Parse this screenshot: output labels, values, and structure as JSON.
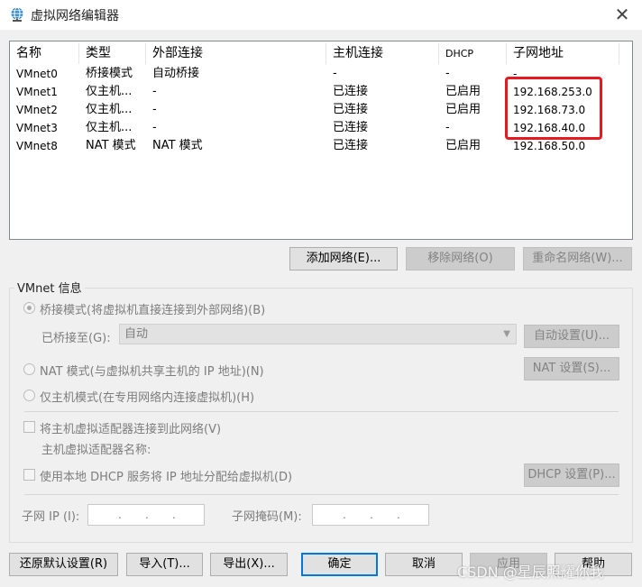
{
  "window": {
    "title": "虚拟网络编辑器",
    "close_symbol": "✕"
  },
  "table": {
    "headers": [
      "名称",
      "类型",
      "外部连接",
      "主机连接",
      "DHCP",
      "子网地址"
    ],
    "rows": [
      [
        "VMnet0",
        "桥接模式",
        "自动桥接",
        "-",
        "-",
        "-"
      ],
      [
        "VMnet1",
        "仅主机...",
        "-",
        "已连接",
        "已启用",
        "192.168.253.0"
      ],
      [
        "VMnet2",
        "仅主机...",
        "-",
        "已连接",
        "已启用",
        "192.168.73.0"
      ],
      [
        "VMnet3",
        "仅主机...",
        "-",
        "已连接",
        "-",
        "192.168.40.0"
      ],
      [
        "VMnet8",
        "NAT 模式",
        "NAT 模式",
        "已连接",
        "已启用",
        "192.168.50.0"
      ]
    ],
    "highlight_color": "#e8181f"
  },
  "net_buttons": {
    "add": "添加网络(E)...",
    "remove": "移除网络(O)",
    "rename": "重命名网络(W)..."
  },
  "vmnet_info": {
    "legend": "VMnet 信息",
    "bridge_label": "桥接模式(将虚拟机直接连接到外部网络)(B)",
    "bridged_to_label": "已桥接至(G):",
    "bridged_to_value": "自动",
    "auto_settings": "自动设置(U)...",
    "nat_label": "NAT 模式(与虚拟机共享主机的 IP 地址)(N)",
    "nat_settings": "NAT 设置(S)...",
    "host_only_label": "仅主机模式(在专用网络内连接虚拟机)(H)",
    "connect_adapter_label": "将主机虚拟适配器连接到此网络(V)",
    "adapter_name_label": "主机虚拟适配器名称:",
    "dhcp_label": "使用本地 DHCP 服务将 IP 地址分配给虚拟机(D)",
    "dhcp_settings": "DHCP 设置(P)...",
    "subnet_ip_label": "子网 IP (I):",
    "subnet_mask_label": "子网掩码(M):"
  },
  "footer": {
    "restore": "还原默认设置(R)",
    "import": "导入(T)...",
    "export": "导出(X)...",
    "ok": "确定",
    "cancel": "取消",
    "apply": "应用",
    "help": "帮助"
  },
  "watermark": "CSDN @星辰照耀你我",
  "colors": {
    "accent": "#0078d7",
    "window_bg": "#f0f0f0"
  }
}
